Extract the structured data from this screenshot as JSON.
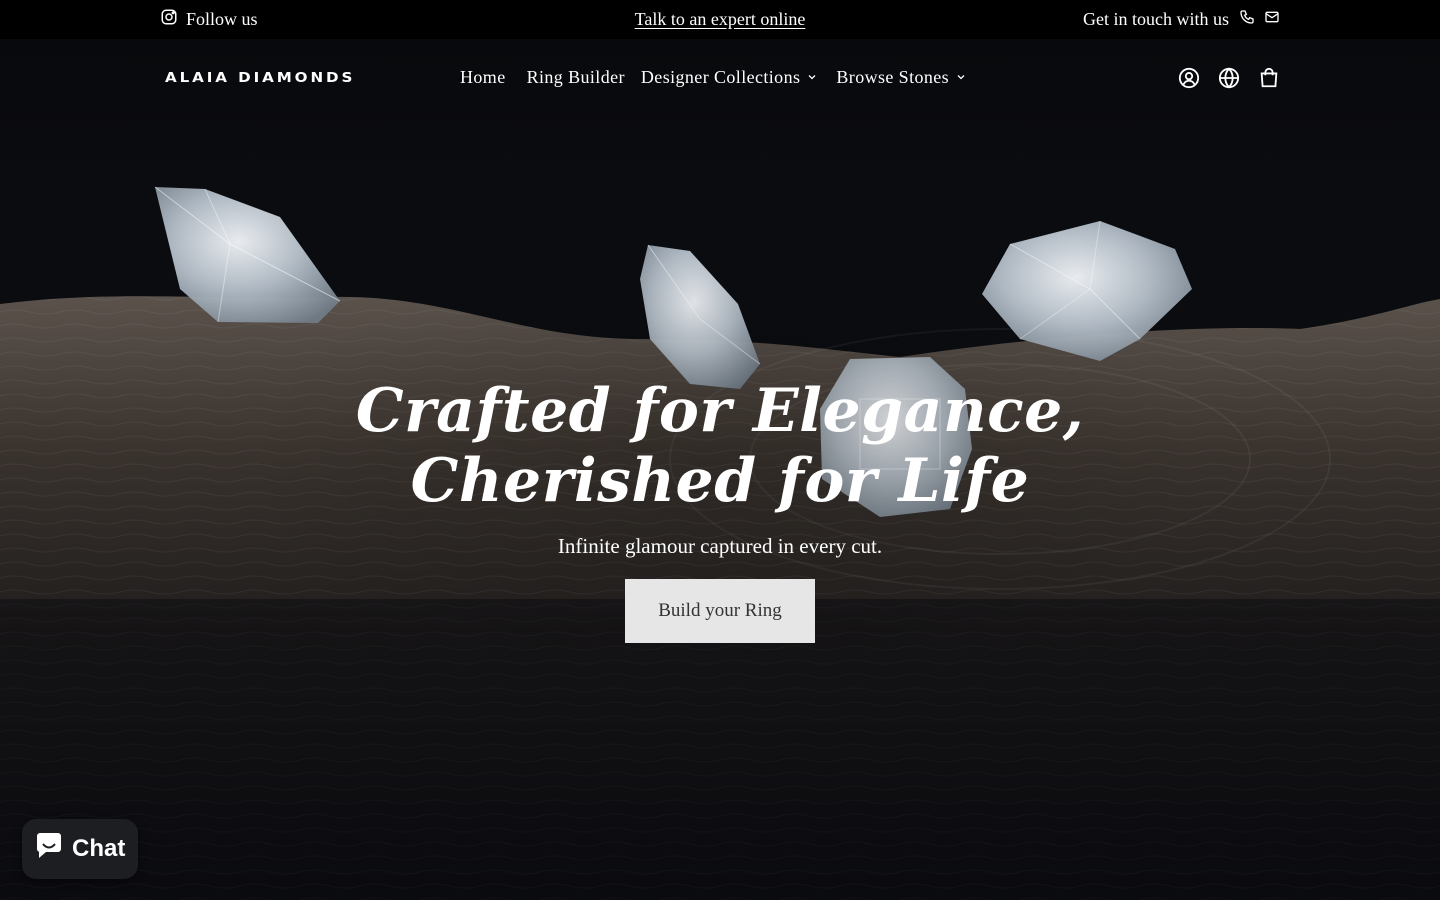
{
  "topbar": {
    "follow_label": "Follow us",
    "expert_link": "Talk to an expert online",
    "contact_label": "Get in touch with us"
  },
  "header": {
    "logo": "ALAIA DIAMONDS",
    "nav": [
      {
        "label": "Home"
      },
      {
        "label": "Ring Builder"
      },
      {
        "label": "Designer Collections"
      },
      {
        "label": "Browse Stones"
      }
    ]
  },
  "hero": {
    "headline_line1": "Crafted for Elegance,",
    "headline_line2": "Cherished for Life",
    "subtitle": "Infinite glamour captured in every cut.",
    "cta_label": "Build your Ring"
  },
  "chat": {
    "label": "Chat"
  },
  "icons": {
    "instagram": "instagram-icon",
    "phone": "phone-icon",
    "mail": "mail-icon",
    "account": "account-icon",
    "globe": "globe-icon",
    "cart": "shopping-bag-icon",
    "chevron": "chevron-down-icon"
  },
  "colors": {
    "topbar_bg": "#000000",
    "hero_bg": "#0b0c10",
    "cta_bg": "#e6e6e6",
    "chat_bg": "#1c1e22"
  }
}
